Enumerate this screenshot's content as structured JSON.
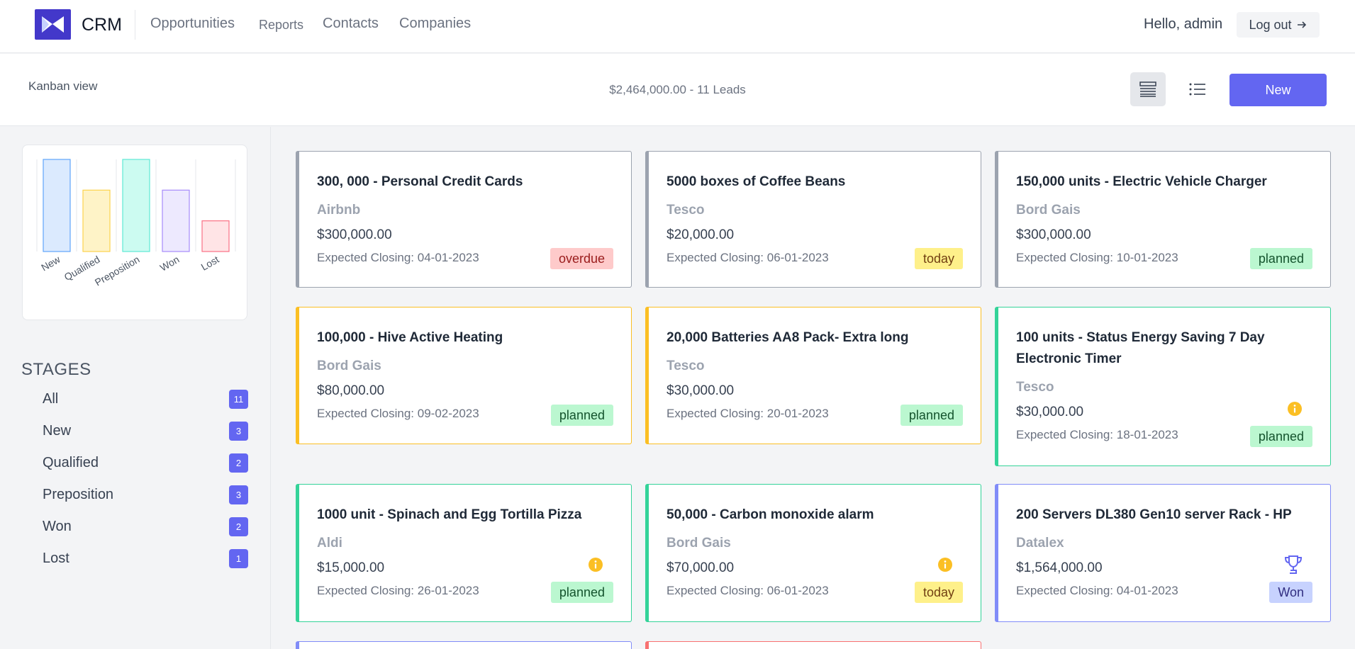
{
  "app": {
    "brand": "CRM"
  },
  "nav": {
    "links": [
      "Opportunities",
      "Reports",
      "Contacts",
      "Companies"
    ],
    "greeting": "Hello, admin",
    "logout_label": "Log out"
  },
  "toolbar": {
    "view_title": "Kanban view",
    "summary_amount": "$2,464,000.00",
    "summary_sep": "-",
    "summary_leads": "11 Leads",
    "new_label": "New"
  },
  "chart_data": {
    "type": "bar",
    "categories": [
      "New",
      "Qualified",
      "Preposition",
      "Won",
      "Lost"
    ],
    "values": [
      3,
      2,
      3,
      2,
      1
    ],
    "ylim": [
      0,
      3
    ],
    "colors": {
      "fill": [
        "#dbeafe",
        "#fef3c7",
        "#ccfbf1",
        "#ede9fe",
        "#ffe4e6"
      ],
      "stroke": [
        "#60a5fa",
        "#fcd34d",
        "#5eead4",
        "#a78bfa",
        "#fb7185"
      ]
    }
  },
  "stages": {
    "title": "STAGES",
    "items": [
      {
        "label": "All",
        "count": "11"
      },
      {
        "label": "New",
        "count": "3"
      },
      {
        "label": "Qualified",
        "count": "2"
      },
      {
        "label": "Preposition",
        "count": "3"
      },
      {
        "label": "Won",
        "count": "2"
      },
      {
        "label": "Lost",
        "count": "1"
      }
    ]
  },
  "cards": [
    {
      "title": "300, 000 - Personal Credit Cards",
      "company": "Airbnb",
      "amount": "$300,000.00",
      "closing": "Expected Closing: 04-01-2023",
      "badge": "overdue",
      "stage_color": "#9ca3af"
    },
    {
      "title": "5000 boxes of Coffee Beans",
      "company": "Tesco",
      "amount": "$20,000.00",
      "closing": "Expected Closing: 06-01-2023",
      "badge": "today",
      "stage_color": "#9ca3af"
    },
    {
      "title": "150,000 units - Electric Vehicle Charger",
      "company": "Bord Gais",
      "amount": "$300,000.00",
      "closing": "Expected Closing: 10-01-2023",
      "badge": "planned",
      "stage_color": "#9ca3af"
    },
    {
      "title": "100,000 - Hive Active Heating",
      "company": "Bord Gais",
      "amount": "$80,000.00",
      "closing": "Expected Closing: 09-02-2023",
      "badge": "planned",
      "stage_color": "#fbbf24"
    },
    {
      "title": "20,000 Batteries AA8 Pack- Extra long",
      "company": "Tesco",
      "amount": "$30,000.00",
      "closing": "Expected Closing: 20-01-2023",
      "badge": "planned",
      "stage_color": "#fbbf24"
    },
    {
      "title": "100 units - Status Energy Saving 7 Day Electronic Timer",
      "company": "Tesco",
      "amount": "$30,000.00",
      "closing": "Expected Closing: 18-01-2023",
      "badge": "planned",
      "stage_color": "#34d399"
    },
    {
      "title": "1000 unit - Spinach and Egg Tortilla Pizza",
      "company": "Aldi",
      "amount": "$15,000.00",
      "closing": "Expected Closing: 26-01-2023",
      "badge": "planned",
      "stage_color": "#34d399"
    },
    {
      "title": "50,000 - Carbon monoxide alarm",
      "company": "Bord Gais",
      "amount": "$70,000.00",
      "closing": "Expected Closing: 06-01-2023",
      "badge": "today",
      "stage_color": "#34d399"
    },
    {
      "title": "200 Servers DL380 Gen10 server Rack - HP",
      "company": "Datalex",
      "amount": "$1,564,000.00",
      "closing": "Expected Closing: 04-01-2023",
      "badge": "Won",
      "stage_color": "#818cf8"
    }
  ],
  "partial_cards": [
    {
      "stage_color": "#818cf8"
    },
    {
      "stage_color": "#f87171"
    }
  ]
}
